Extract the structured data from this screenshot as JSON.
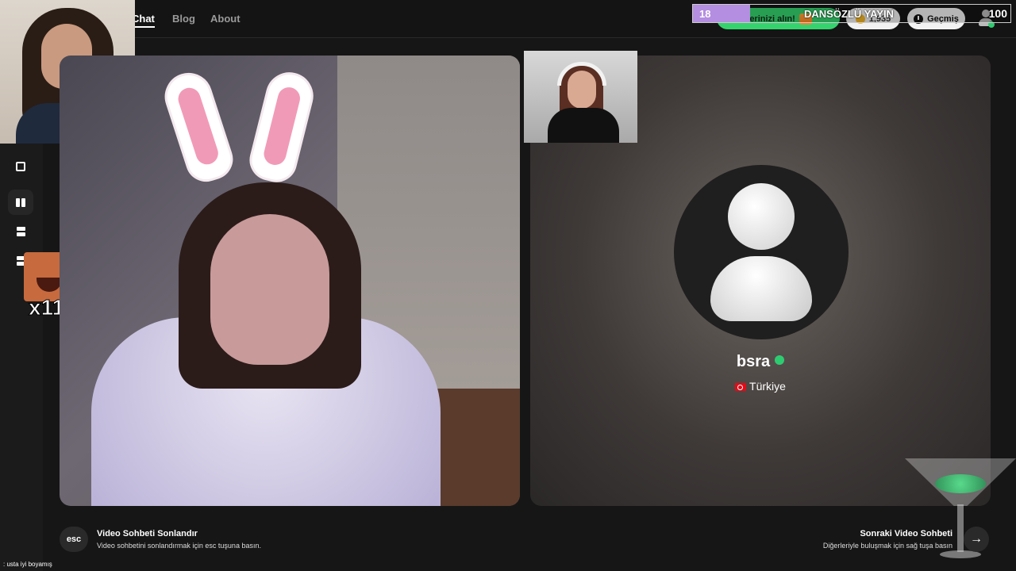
{
  "nav": {
    "links": [
      "Chat",
      "Blog",
      "About"
    ],
    "rewards_label": "llerinizi alın!",
    "coins": "1,935",
    "history_label": "Geçmiş"
  },
  "stream_overlay": {
    "goal_start": "18",
    "goal_title": "DANSÖZLÜ YAYIN",
    "goal_end": "100",
    "goal_progress": 0.18,
    "emote_count": "x11",
    "chat": {
      "user": "",
      "message": ": usta iyi boyamış"
    }
  },
  "peer": {
    "name": "bsra",
    "country": "Türkiye"
  },
  "hints": {
    "esc_key": "esc",
    "end_title": "Video Sohbeti Sonlandır",
    "end_sub": "Video sohbetini sonlandırmak için esc tuşuna basın.",
    "next_title": "Sonraki Video Sohbeti",
    "next_sub": "Diğerleriyle buluşmak için sağ tuşa basın"
  },
  "colors": {
    "accent_green": "#34d36e",
    "background": "#161616",
    "goal_fill": "#b48ee0"
  },
  "icons": [
    "shuffle-icon",
    "columns-icon",
    "rows-icon",
    "grid-icon",
    "clock-icon",
    "coin-icon",
    "gift-icon",
    "user-icon",
    "arrow-right-icon"
  ]
}
